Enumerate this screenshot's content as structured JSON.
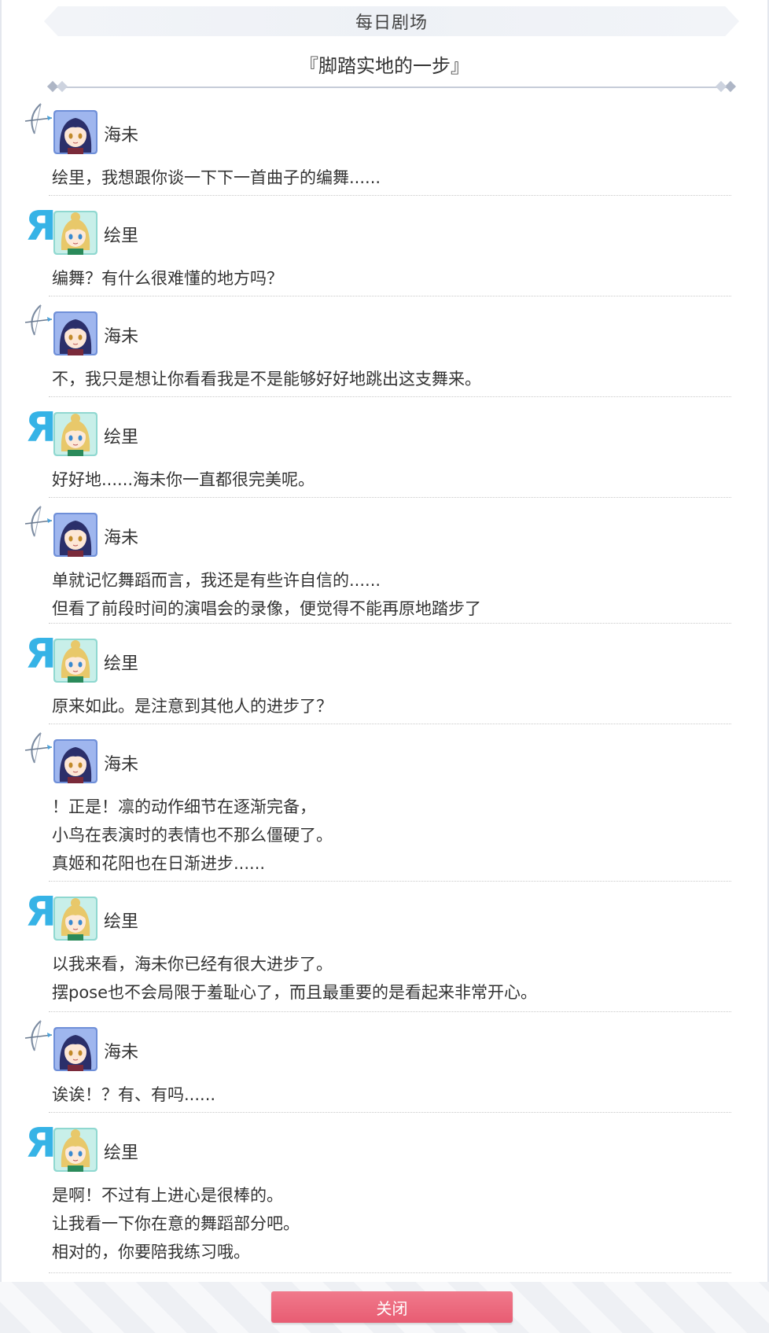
{
  "header": {
    "title": "每日剧场"
  },
  "story": {
    "title": "『脚踏实地的一步』"
  },
  "footer": {
    "close_label": "关闭"
  },
  "dialogue": [
    {
      "speaker": "海未",
      "lines": [
        "绘里，我想跟你谈一下下一首曲子的编舞......"
      ]
    },
    {
      "speaker": "绘里",
      "lines": [
        "编舞？有什么很难懂的地方吗？"
      ]
    },
    {
      "speaker": "海未",
      "lines": [
        "不，我只是想让你看看我是不是能够好好地跳出这支舞来。"
      ]
    },
    {
      "speaker": "绘里",
      "lines": [
        "好好地......海未你一直都很完美呢。"
      ]
    },
    {
      "speaker": "海未",
      "lines": [
        "单就记忆舞蹈而言，我还是有些许自信的......",
        "但看了前段时间的演唱会的录像，便觉得不能再原地踏步了"
      ]
    },
    {
      "speaker": "绘里",
      "lines": [
        "原来如此。是注意到其他人的进步了？"
      ]
    },
    {
      "speaker": "海未",
      "lines": [
        "！正是！凛的动作细节在逐渐完备，",
        "小鸟在表演时的表情也不那么僵硬了。",
        "真姬和花阳也在日渐进步......"
      ]
    },
    {
      "speaker": "绘里",
      "lines": [
        "以我来看，海未你已经有很大进步了。",
        "摆pose也不会局限于羞耻心了，而且最重要的是看起来非常开心。"
      ]
    },
    {
      "speaker": "海未",
      "lines": [
        "诶诶！？有、有吗......"
      ]
    },
    {
      "speaker": "绘里",
      "lines": [
        "是啊！不过有上进心是很棒的。",
        "让我看一下你在意的舞蹈部分吧。",
        "相对的，你要陪我练习哦。"
      ]
    }
  ]
}
